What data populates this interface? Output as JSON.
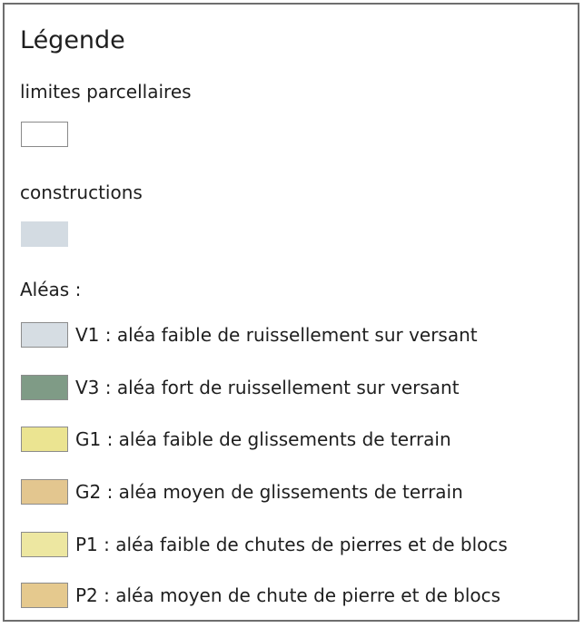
{
  "legend": {
    "title": "Légende",
    "parcel_limits": {
      "label": "limites parcellaires",
      "swatch_color": "#ffffff"
    },
    "constructions": {
      "label": "constructions",
      "swatch_color": "#d3dbe2"
    },
    "hazards_heading": "Aléas :",
    "hazards": [
      {
        "label": "V1 : aléa faible de ruissellement sur versant",
        "color": "#d6dde3"
      },
      {
        "label": "V3 : aléa fort de ruissellement sur versant",
        "color": "#7f9b86"
      },
      {
        "label": "G1 : aléa faible de glissements de terrain",
        "color": "#ebe491"
      },
      {
        "label": "G2 : aléa moyen de glissements de terrain",
        "color": "#e3c68f"
      },
      {
        "label": "P1 : aléa faible de chutes de pierres et de blocs",
        "color": "#ede7a1"
      },
      {
        "label": "P2 : aléa moyen de chute de pierre et de blocs",
        "color": "#e5c98e"
      }
    ]
  }
}
